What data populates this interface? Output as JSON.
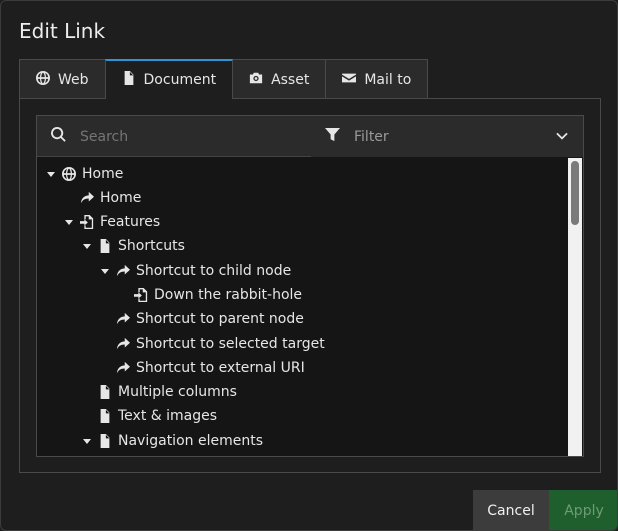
{
  "modal": {
    "title": "Edit Link"
  },
  "tabs": [
    {
      "label": "Web",
      "icon": "globe-icon",
      "active": false
    },
    {
      "label": "Document",
      "icon": "file-icon",
      "active": true
    },
    {
      "label": "Asset",
      "icon": "camera-icon",
      "active": false
    },
    {
      "label": "Mail to",
      "icon": "envelope-icon",
      "active": false
    }
  ],
  "search": {
    "placeholder": "Search"
  },
  "filter": {
    "label": "Filter"
  },
  "tree": [
    {
      "label": "Home",
      "icon": "globe-icon",
      "expanded": true,
      "level": 0
    },
    {
      "label": "Home",
      "icon": "shortcut-icon",
      "expanded": null,
      "level": 1
    },
    {
      "label": "Features",
      "icon": "mountpoint-icon",
      "expanded": true,
      "level": 1
    },
    {
      "label": "Shortcuts",
      "icon": "file-icon",
      "expanded": true,
      "level": 2
    },
    {
      "label": "Shortcut to child node",
      "icon": "shortcut-icon",
      "expanded": true,
      "level": 3
    },
    {
      "label": "Down the rabbit-hole",
      "icon": "mountpoint-icon",
      "expanded": null,
      "level": 4
    },
    {
      "label": "Shortcut to parent node",
      "icon": "shortcut-icon",
      "expanded": null,
      "level": 3
    },
    {
      "label": "Shortcut to selected target",
      "icon": "shortcut-icon",
      "expanded": null,
      "level": 3
    },
    {
      "label": "Shortcut to external URI",
      "icon": "shortcut-icon",
      "expanded": null,
      "level": 3
    },
    {
      "label": "Multiple columns",
      "icon": "file-icon",
      "expanded": null,
      "level": 2
    },
    {
      "label": "Text & images",
      "icon": "file-icon",
      "expanded": null,
      "level": 2
    },
    {
      "label": "Navigation elements",
      "icon": "file-icon",
      "expanded": true,
      "level": 2
    }
  ],
  "footer": {
    "cancel_label": "Cancel",
    "apply_label": "Apply"
  },
  "colors": {
    "accent": "#2d94d6",
    "apply_bg": "#1f5f2d",
    "apply_text": "#6c9c78"
  }
}
